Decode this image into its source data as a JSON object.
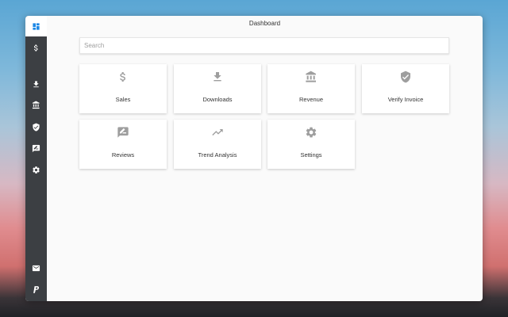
{
  "header": {
    "title": "Dashboard"
  },
  "search": {
    "placeholder": "Search"
  },
  "sidebar": {
    "items": [
      {
        "icon": "dashboard-icon"
      },
      {
        "icon": "dollar-icon"
      },
      {
        "icon": "download-icon"
      },
      {
        "icon": "bank-icon"
      },
      {
        "icon": "verified-shield-icon"
      },
      {
        "icon": "rate-review-icon"
      },
      {
        "icon": "gear-icon"
      }
    ],
    "bottom_items": [
      {
        "icon": "mail-icon"
      },
      {
        "icon": "paypal-icon"
      }
    ],
    "accent_color": "#1e88e5"
  },
  "cards": [
    {
      "label": "Sales",
      "icon": "dollar-icon"
    },
    {
      "label": "Downloads",
      "icon": "download-icon"
    },
    {
      "label": "Revenue",
      "icon": "bank-icon"
    },
    {
      "label": "Verify Invoice",
      "icon": "verified-shield-icon"
    },
    {
      "label": "Reviews",
      "icon": "rate-review-icon"
    },
    {
      "label": "Trend Analysis",
      "icon": "trending-up-icon"
    },
    {
      "label": "Settings",
      "icon": "gear-icon"
    }
  ]
}
